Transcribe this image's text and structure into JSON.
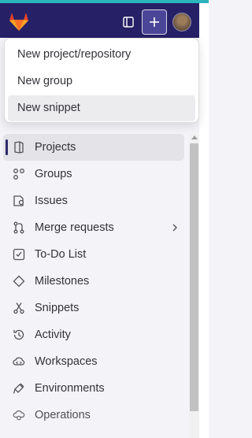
{
  "header": {
    "logo_icon": "gitlab-tanuki-icon",
    "toggle_icon": "sidebar-toggle-icon",
    "plus_icon": "plus-icon",
    "avatar_icon": "user-avatar"
  },
  "dropdown": {
    "items": [
      {
        "label": "New project/repository"
      },
      {
        "label": "New group"
      },
      {
        "label": "New snippet"
      }
    ]
  },
  "nav": {
    "items": [
      {
        "label": "Projects",
        "icon": "project-icon"
      },
      {
        "label": "Groups",
        "icon": "group-icon"
      },
      {
        "label": "Issues",
        "icon": "issues-icon"
      },
      {
        "label": "Merge requests",
        "icon": "merge-request-icon"
      },
      {
        "label": "To-Do List",
        "icon": "todo-icon"
      },
      {
        "label": "Milestones",
        "icon": "milestone-icon"
      },
      {
        "label": "Snippets",
        "icon": "snippet-icon"
      },
      {
        "label": "Activity",
        "icon": "history-icon"
      },
      {
        "label": "Workspaces",
        "icon": "workspace-icon"
      },
      {
        "label": "Environments",
        "icon": "environment-icon"
      },
      {
        "label": "Operations",
        "icon": "operations-icon"
      }
    ]
  },
  "colors": {
    "topbar": "#262066",
    "accent_strip": "#2cb4bd",
    "logo": "#e24329"
  }
}
